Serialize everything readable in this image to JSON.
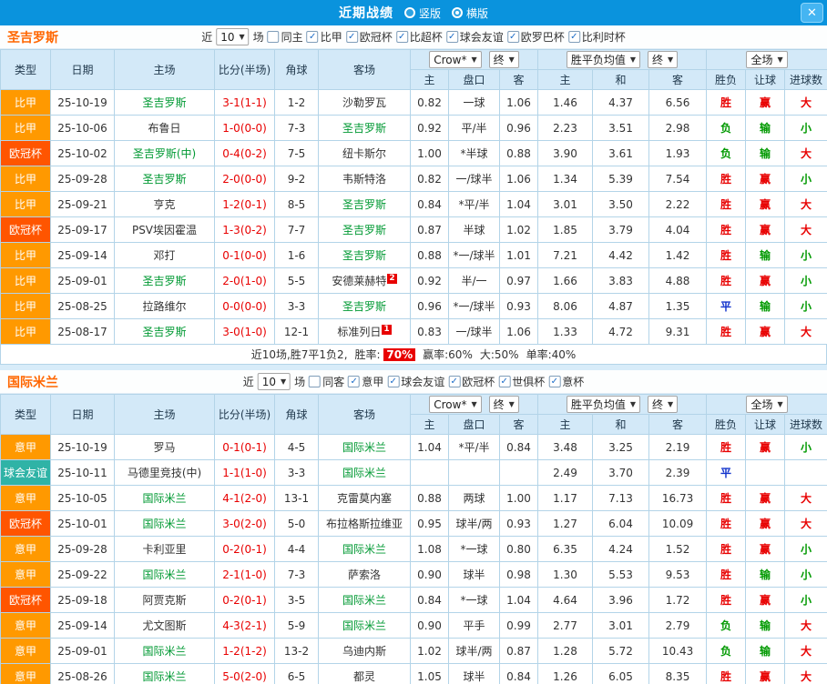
{
  "titlebar": {
    "title": "近期战绩",
    "radios": [
      {
        "label": "竖版",
        "selected": false
      },
      {
        "label": "横版",
        "selected": true
      }
    ]
  },
  "icons": {
    "close": "✕",
    "dropdown_arrow": "▼",
    "check": "✓"
  },
  "colors": {
    "league": {
      "比甲": "#ff9900",
      "意甲": "#ff9900",
      "欧冠杯": "#ff5500",
      "球会友谊": "#2fb3a6"
    },
    "win": "#e80000",
    "loss": "#009900",
    "draw": "#1133cc",
    "team": "#009933",
    "score": "#e80000"
  },
  "table_header": {
    "type": "类型",
    "date": "日期",
    "home": "主场",
    "score": "比分(半场)",
    "corner": "角球",
    "away": "客场",
    "odds_select": "Crow*",
    "final_select": "终",
    "avg_select": "胜平负均值",
    "final_select2": "终",
    "scope_select": "全场",
    "home_short": "主",
    "handicap": "盘口",
    "away_short": "客",
    "home_short2": "主",
    "draw_short": "和",
    "away_short2": "客",
    "wdl": "胜负",
    "let_goal": "让球",
    "goals": "进球数"
  },
  "sections": [
    {
      "team": "圣吉罗斯",
      "filter": {
        "near": "近",
        "count": "10",
        "games": "场",
        "same": {
          "label": "同主",
          "checked": false
        },
        "leagues": [
          {
            "label": "比甲",
            "checked": true
          },
          {
            "label": "欧冠杯",
            "checked": true
          },
          {
            "label": "比超杯",
            "checked": true
          },
          {
            "label": "球会友谊",
            "checked": true
          },
          {
            "label": "欧罗巴杯",
            "checked": true
          },
          {
            "label": "比利时杯",
            "checked": true
          }
        ]
      },
      "rows": [
        {
          "league": "比甲",
          "date": "25-10-19",
          "home": "圣吉罗斯",
          "home_hl": true,
          "score": "3-1(1-1)",
          "corner": "1-2",
          "away": "沙勒罗瓦",
          "away_hl": false,
          "odds": [
            "0.82",
            "一球",
            "1.06"
          ],
          "avg": [
            "1.46",
            "4.37",
            "6.56"
          ],
          "wdl": "胜",
          "let": "赢",
          "goal": "大"
        },
        {
          "league": "比甲",
          "date": "25-10-06",
          "home": "布鲁日",
          "home_hl": false,
          "score": "1-0(0-0)",
          "corner": "7-3",
          "away": "圣吉罗斯",
          "away_hl": true,
          "odds": [
            "0.92",
            "平/半",
            "0.96"
          ],
          "avg": [
            "2.23",
            "3.51",
            "2.98"
          ],
          "wdl": "负",
          "let": "输",
          "goal": "小"
        },
        {
          "league": "欧冠杯",
          "date": "25-10-02",
          "home": "圣吉罗斯(中)",
          "home_hl": true,
          "score": "0-4(0-2)",
          "corner": "7-5",
          "away": "纽卡斯尔",
          "away_hl": false,
          "odds": [
            "1.00",
            "*半球",
            "0.88"
          ],
          "avg": [
            "3.90",
            "3.61",
            "1.93"
          ],
          "wdl": "负",
          "let": "输",
          "goal": "大"
        },
        {
          "league": "比甲",
          "date": "25-09-28",
          "home": "圣吉罗斯",
          "home_hl": true,
          "score": "2-0(0-0)",
          "corner": "9-2",
          "away": "韦斯特洛",
          "away_hl": false,
          "odds": [
            "0.82",
            "一/球半",
            "1.06"
          ],
          "avg": [
            "1.34",
            "5.39",
            "7.54"
          ],
          "wdl": "胜",
          "let": "赢",
          "goal": "小"
        },
        {
          "league": "比甲",
          "date": "25-09-21",
          "home": "亨克",
          "home_hl": false,
          "score": "1-2(0-1)",
          "corner": "8-5",
          "away": "圣吉罗斯",
          "away_hl": true,
          "odds": [
            "0.84",
            "*平/半",
            "1.04"
          ],
          "avg": [
            "3.01",
            "3.50",
            "2.22"
          ],
          "wdl": "胜",
          "let": "赢",
          "goal": "大"
        },
        {
          "league": "欧冠杯",
          "date": "25-09-17",
          "home": "PSV埃因霍温",
          "home_hl": false,
          "score": "1-3(0-2)",
          "corner": "7-7",
          "away": "圣吉罗斯",
          "away_hl": true,
          "odds": [
            "0.87",
            "半球",
            "1.02"
          ],
          "avg": [
            "1.85",
            "3.79",
            "4.04"
          ],
          "wdl": "胜",
          "let": "赢",
          "goal": "大"
        },
        {
          "league": "比甲",
          "date": "25-09-14",
          "home": "邓打",
          "home_hl": false,
          "score": "0-1(0-0)",
          "corner": "1-6",
          "away": "圣吉罗斯",
          "away_hl": true,
          "odds": [
            "0.88",
            "*一/球半",
            "1.01"
          ],
          "avg": [
            "7.21",
            "4.42",
            "1.42"
          ],
          "wdl": "胜",
          "let": "输",
          "goal": "小"
        },
        {
          "league": "比甲",
          "date": "25-09-01",
          "home": "圣吉罗斯",
          "home_hl": true,
          "score": "2-0(1-0)",
          "corner": "5-5",
          "away": "安德莱赫特",
          "away_hl": false,
          "away_badge": "2",
          "odds": [
            "0.92",
            "半/一",
            "0.97"
          ],
          "avg": [
            "1.66",
            "3.83",
            "4.88"
          ],
          "wdl": "胜",
          "let": "赢",
          "goal": "小"
        },
        {
          "league": "比甲",
          "date": "25-08-25",
          "home": "拉路维尔",
          "home_hl": false,
          "score": "0-0(0-0)",
          "corner": "3-3",
          "away": "圣吉罗斯",
          "away_hl": true,
          "odds": [
            "0.96",
            "*一/球半",
            "0.93"
          ],
          "avg": [
            "8.06",
            "4.87",
            "1.35"
          ],
          "wdl": "平",
          "let": "输",
          "goal": "小"
        },
        {
          "league": "比甲",
          "date": "25-08-17",
          "home": "圣吉罗斯",
          "home_hl": true,
          "score": "3-0(1-0)",
          "corner": "12-1",
          "away": "标准列日",
          "away_hl": false,
          "away_badge": "1",
          "odds": [
            "0.83",
            "一/球半",
            "1.06"
          ],
          "avg": [
            "1.33",
            "4.72",
            "9.31"
          ],
          "wdl": "胜",
          "let": "赢",
          "goal": "大"
        }
      ],
      "footer": {
        "summary": "近10场,胜7平1负2,",
        "win_rate_label": "胜率:",
        "win_rate_value": "70%",
        "segments": [
          "赢率:60%",
          "大:50%",
          "单率:40%"
        ]
      }
    },
    {
      "team": "国际米兰",
      "filter": {
        "near": "近",
        "count": "10",
        "games": "场",
        "same": {
          "label": "同客",
          "checked": false
        },
        "leagues": [
          {
            "label": "意甲",
            "checked": true
          },
          {
            "label": "球会友谊",
            "checked": true
          },
          {
            "label": "欧冠杯",
            "checked": true
          },
          {
            "label": "世俱杯",
            "checked": true
          },
          {
            "label": "意杯",
            "checked": true
          }
        ]
      },
      "rows": [
        {
          "league": "意甲",
          "date": "25-10-19",
          "home": "罗马",
          "home_hl": false,
          "score": "0-1(0-1)",
          "corner": "4-5",
          "away": "国际米兰",
          "away_hl": true,
          "odds": [
            "1.04",
            "*平/半",
            "0.84"
          ],
          "avg": [
            "3.48",
            "3.25",
            "2.19"
          ],
          "wdl": "胜",
          "let": "赢",
          "goal": "小"
        },
        {
          "league": "球会友谊",
          "date": "25-10-11",
          "home": "马德里竞技(中)",
          "home_hl": false,
          "score": "1-1(1-0)",
          "corner": "3-3",
          "away": "国际米兰",
          "away_hl": true,
          "odds": [
            "",
            "",
            ""
          ],
          "avg": [
            "2.49",
            "3.70",
            "2.39"
          ],
          "wdl": "平",
          "let": "",
          "goal": ""
        },
        {
          "league": "意甲",
          "date": "25-10-05",
          "home": "国际米兰",
          "home_hl": true,
          "score": "4-1(2-0)",
          "corner": "13-1",
          "away": "克雷莫内塞",
          "away_hl": false,
          "odds": [
            "0.88",
            "两球",
            "1.00"
          ],
          "avg": [
            "1.17",
            "7.13",
            "16.73"
          ],
          "wdl": "胜",
          "let": "赢",
          "goal": "大"
        },
        {
          "league": "欧冠杯",
          "date": "25-10-01",
          "home": "国际米兰",
          "home_hl": true,
          "score": "3-0(2-0)",
          "corner": "5-0",
          "away": "布拉格斯拉维亚",
          "away_hl": false,
          "odds": [
            "0.95",
            "球半/两",
            "0.93"
          ],
          "avg": [
            "1.27",
            "6.04",
            "10.09"
          ],
          "wdl": "胜",
          "let": "赢",
          "goal": "大"
        },
        {
          "league": "意甲",
          "date": "25-09-28",
          "home": "卡利亚里",
          "home_hl": false,
          "score": "0-2(0-1)",
          "corner": "4-4",
          "away": "国际米兰",
          "away_hl": true,
          "odds": [
            "1.08",
            "*一球",
            "0.80"
          ],
          "avg": [
            "6.35",
            "4.24",
            "1.52"
          ],
          "wdl": "胜",
          "let": "赢",
          "goal": "小"
        },
        {
          "league": "意甲",
          "date": "25-09-22",
          "home": "国际米兰",
          "home_hl": true,
          "score": "2-1(1-0)",
          "corner": "7-3",
          "away": "萨索洛",
          "away_hl": false,
          "odds": [
            "0.90",
            "球半",
            "0.98"
          ],
          "avg": [
            "1.30",
            "5.53",
            "9.53"
          ],
          "wdl": "胜",
          "let": "输",
          "goal": "小"
        },
        {
          "league": "欧冠杯",
          "date": "25-09-18",
          "home": "阿贾克斯",
          "home_hl": false,
          "score": "0-2(0-1)",
          "corner": "3-5",
          "away": "国际米兰",
          "away_hl": true,
          "odds": [
            "0.84",
            "*一球",
            "1.04"
          ],
          "avg": [
            "4.64",
            "3.96",
            "1.72"
          ],
          "wdl": "胜",
          "let": "赢",
          "goal": "小"
        },
        {
          "league": "意甲",
          "date": "25-09-14",
          "home": "尤文图斯",
          "home_hl": false,
          "score": "4-3(2-1)",
          "corner": "5-9",
          "away": "国际米兰",
          "away_hl": true,
          "odds": [
            "0.90",
            "平手",
            "0.99"
          ],
          "avg": [
            "2.77",
            "3.01",
            "2.79"
          ],
          "wdl": "负",
          "let": "输",
          "goal": "大"
        },
        {
          "league": "意甲",
          "date": "25-09-01",
          "home": "国际米兰",
          "home_hl": true,
          "score": "1-2(1-2)",
          "corner": "13-2",
          "away": "乌迪内斯",
          "away_hl": false,
          "odds": [
            "1.02",
            "球半/两",
            "0.87"
          ],
          "avg": [
            "1.28",
            "5.72",
            "10.43"
          ],
          "wdl": "负",
          "let": "输",
          "goal": "大"
        },
        {
          "league": "意甲",
          "date": "25-08-26",
          "home": "国际米兰",
          "home_hl": true,
          "score": "5-0(2-0)",
          "corner": "6-5",
          "away": "都灵",
          "away_hl": false,
          "odds": [
            "1.05",
            "球半",
            "0.84"
          ],
          "avg": [
            "1.26",
            "6.05",
            "8.35"
          ],
          "wdl": "胜",
          "let": "赢",
          "goal": "大"
        }
      ]
    }
  ]
}
